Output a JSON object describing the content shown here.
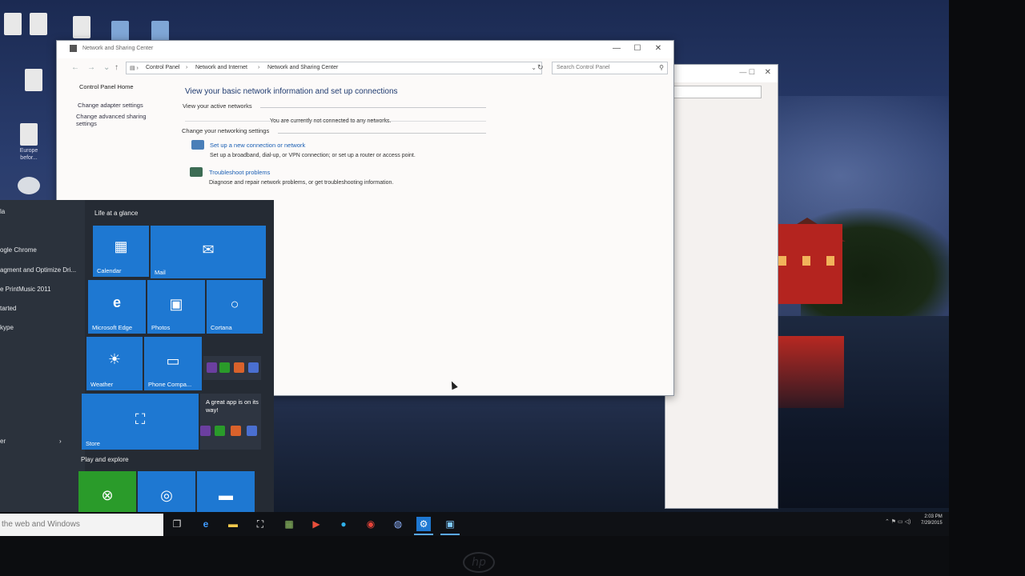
{
  "desktop": {
    "icons": [
      {
        "label": ""
      },
      {
        "label": ""
      },
      {
        "label": ""
      },
      {
        "label": "Europe\nbefor..."
      }
    ]
  },
  "window": {
    "title": "Network and Sharing Center",
    "breadcrumb": [
      "Control Panel",
      "Network and Internet",
      "Network and Sharing Center"
    ],
    "search_placeholder": "Search Control Panel",
    "sidebar": {
      "home": "Control Panel Home",
      "links": [
        "Change adapter settings",
        "Change advanced sharing settings"
      ]
    },
    "heading": "View your basic network information and set up connections",
    "active_networks_label": "View your active networks",
    "status_text": "You are currently not connected to any networks.",
    "change_settings_label": "Change your networking settings",
    "tasks": [
      {
        "title": "Set up a new connection or network",
        "desc": "Set up a broadband, dial-up, or VPN connection; or set up a router or access point."
      },
      {
        "title": "Troubleshoot problems",
        "desc": "Diagnose and repair network problems, or get troubleshooting information."
      }
    ]
  },
  "start": {
    "app_list": [
      "la",
      "ogle Chrome",
      "agment and Optimize Dri...",
      "e PrintMusic 2011",
      "tarted",
      "kype",
      "er"
    ],
    "groups": {
      "life": "Life at a glance",
      "play": "Play and explore"
    },
    "tiles": {
      "calendar": "Calendar",
      "mail": "Mail",
      "edge": "Microsoft Edge",
      "photos": "Photos",
      "cortana": "Cortana",
      "weather": "Weather",
      "phone": "Phone Compa...",
      "store": "Store",
      "great_app": "A great app is on its way!"
    }
  },
  "taskbar": {
    "search_text": "the web and Windows",
    "time": "2:03 PM",
    "date": "7/29/2015"
  },
  "colors": {
    "tile_blue": "#1e78d2",
    "xbox_green": "#2a9b2a",
    "link_blue": "#1a5fb4"
  }
}
